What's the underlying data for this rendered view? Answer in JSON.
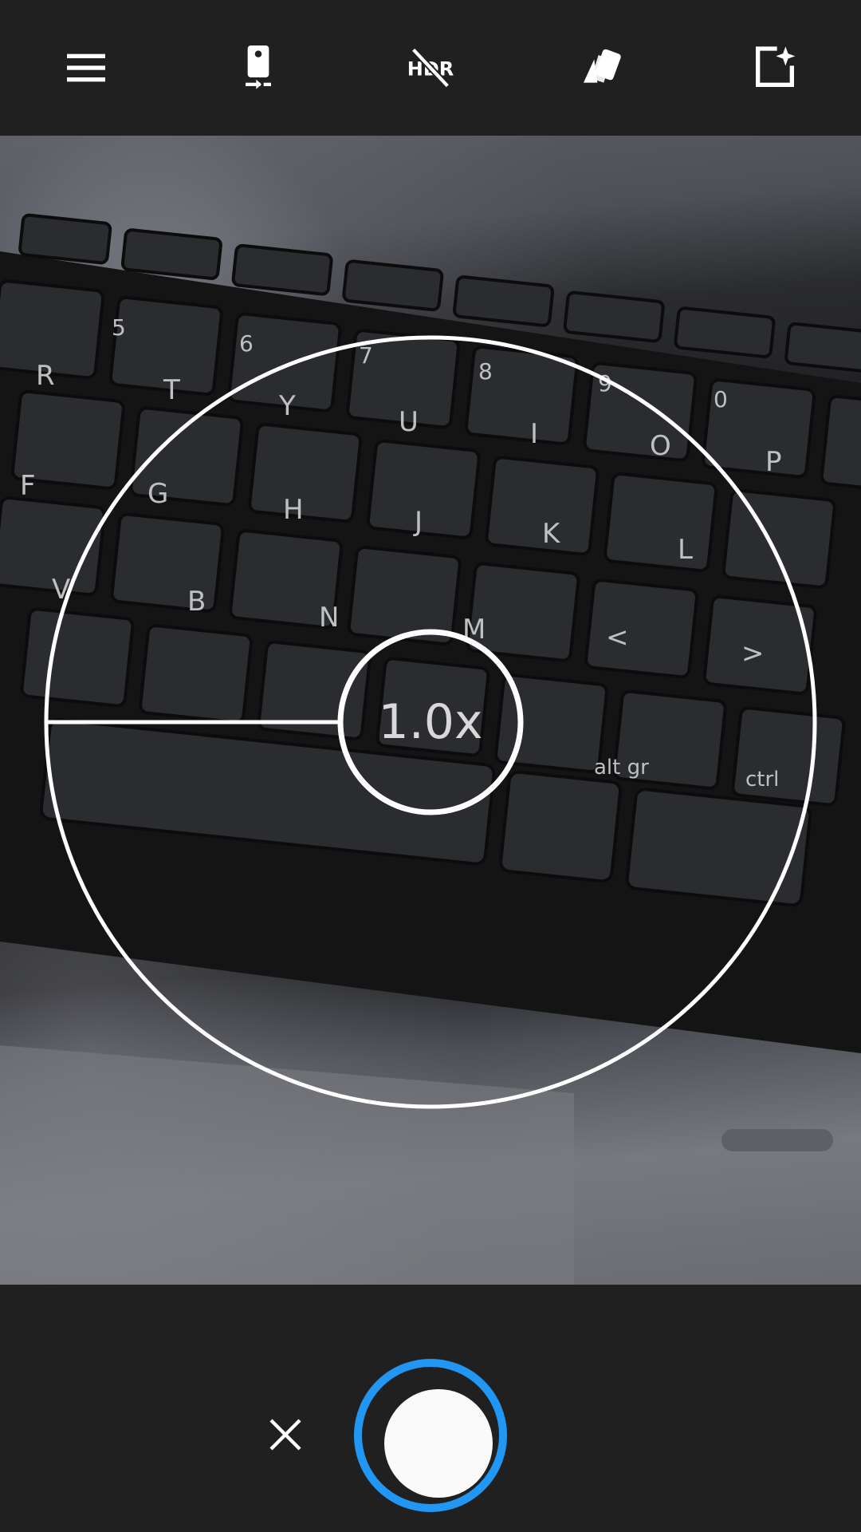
{
  "toolbar": {
    "items": [
      {
        "name": "menu-icon"
      },
      {
        "name": "switch-camera-icon"
      },
      {
        "name": "hdr-off-icon"
      },
      {
        "name": "filters-icon"
      },
      {
        "name": "auto-enhance-icon"
      }
    ]
  },
  "viewfinder": {
    "zoom_label": "1.0x"
  },
  "bottom": {
    "cancel_icon": "close-icon",
    "shutter_color": "#2196f3"
  }
}
